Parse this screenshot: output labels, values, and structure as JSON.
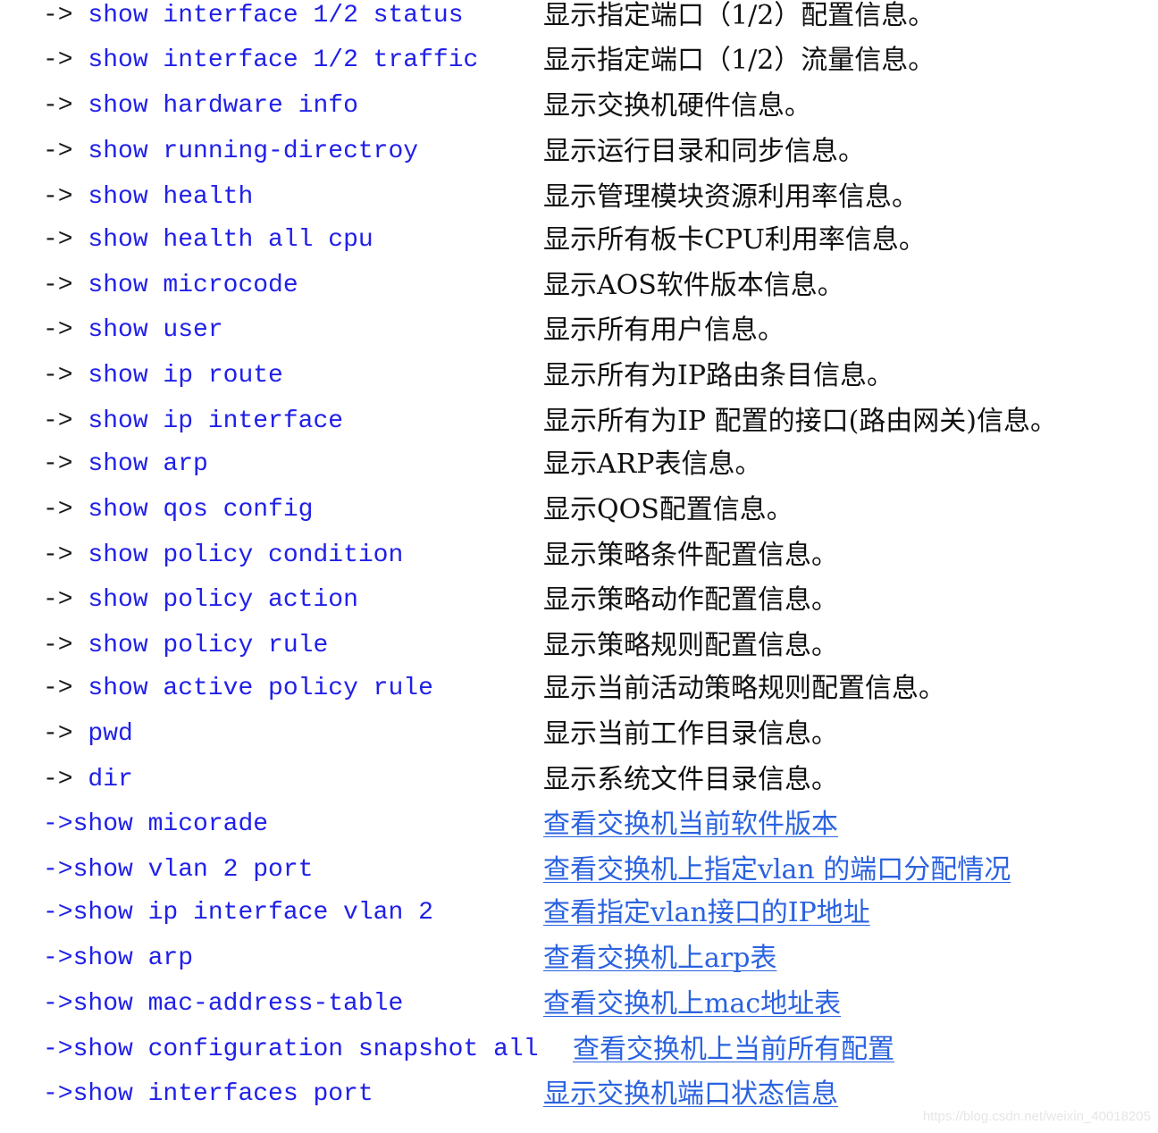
{
  "rows_a": [
    {
      "cmd": "show interface 1/2 status",
      "desc": "显示指定端口（1/2）配置信息。"
    },
    {
      "cmd": "show interface 1/2 traffic",
      "desc": "显示指定端口（1/2）流量信息。"
    },
    {
      "cmd": "show hardware info",
      "desc": "显示交换机硬件信息。"
    },
    {
      "cmd": "show running-directroy",
      "desc": "显示运行目录和同步信息。"
    },
    {
      "cmd": "show health",
      "desc": "显示管理模块资源利用率信息。"
    },
    {
      "cmd": "show health all cpu",
      "desc": "显示所有板卡CPU利用率信息。"
    },
    {
      "cmd": "show microcode",
      "desc": "显示AOS软件版本信息。"
    },
    {
      "cmd": "show user",
      "desc": "显示所有用户信息。"
    },
    {
      "cmd": "show ip route",
      "desc": "显示所有为IP路由条目信息。"
    },
    {
      "cmd": "show ip interface",
      "desc": "显示所有为IP 配置的接口(路由网关)信息。"
    },
    {
      "cmd": "show arp",
      "desc": "显示ARP表信息。"
    },
    {
      "cmd": "show qos config",
      "desc": "显示QOS配置信息。"
    },
    {
      "cmd": "show policy condition",
      "desc": "显示策略条件配置信息。"
    },
    {
      "cmd": "show policy action",
      "desc": "显示策略动作配置信息。"
    },
    {
      "cmd": "show policy rule",
      "desc": "显示策略规则配置信息。"
    },
    {
      "cmd": "show active policy rule",
      "desc": "显示当前活动策略规则配置信息。"
    },
    {
      "cmd": "pwd",
      "desc": "显示当前工作目录信息。"
    },
    {
      "cmd": "dir",
      "desc": "显示系统文件目录信息。"
    }
  ],
  "rows_b": [
    {
      "cmd": "show micorade",
      "desc": "查看交换机当前软件版本"
    },
    {
      "cmd": "show vlan 2 port",
      "desc": "查看交换机上指定vlan 的端口分配情况"
    },
    {
      "cmd": "show ip interface vlan 2",
      "desc": "查看指定vlan接口的IP地址"
    },
    {
      "cmd": "show arp",
      "desc": "查看交换机上arp表"
    },
    {
      "cmd": "show mac-address-table",
      "desc": "查看交换机上mac地址表"
    },
    {
      "cmd": "show configuration snapshot all",
      "desc": "查看交换机上当前所有配置"
    },
    {
      "cmd": "show interfaces port",
      "desc": "显示交换机端口状态信息"
    }
  ],
  "arrow_a": "-> ",
  "arrow_b": "->",
  "watermark": "https://blog.csdn.net/weixin_40018205",
  "colors": {
    "command": "#2020e8",
    "link": "#2a62e0",
    "text": "#111111"
  }
}
